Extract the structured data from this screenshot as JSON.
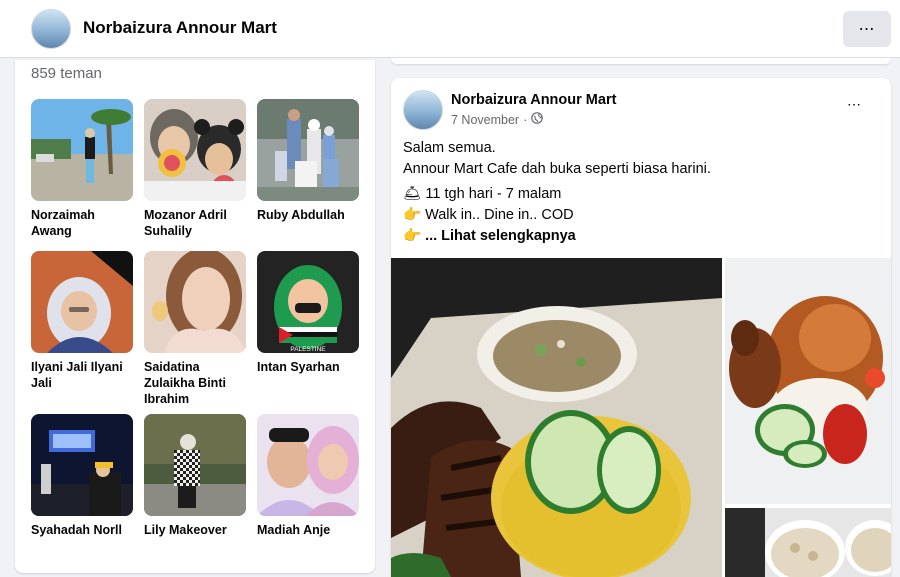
{
  "header": {
    "title": "Norbaizura Annour Mart",
    "more_label": "⋯"
  },
  "friends": {
    "count_text": "859 teman",
    "items": [
      {
        "name": "Norzaimah Awang"
      },
      {
        "name": "Mozanor Adril Suhalily"
      },
      {
        "name": "Ruby Abdullah"
      },
      {
        "name": "Ilyani Jali Ilyani Jali"
      },
      {
        "name": "Saidatina Zulaikha Binti Ibrahim"
      },
      {
        "name": "Intan Syarhan"
      },
      {
        "name": "Syahadah Norll"
      },
      {
        "name": "Lily Makeover"
      },
      {
        "name": "Madiah Anje"
      }
    ]
  },
  "post": {
    "author": "Norbaizura Annour Mart",
    "date": "7 November",
    "dot": "·",
    "more_label": "⋯",
    "text_line1": "Salam semua.",
    "text_line2": "Annour Mart Cafe dah buka seperti biasa harini.",
    "hours": "11 tgh hari - 7 malam",
    "services": "Walk in.. Dine in.. COD",
    "ellipsis": "...",
    "see_more": "Lihat selengkapnya",
    "bell_icon": "🛎",
    "point_icon": "👉"
  },
  "badge": {
    "palestine": "PALESTINE"
  }
}
